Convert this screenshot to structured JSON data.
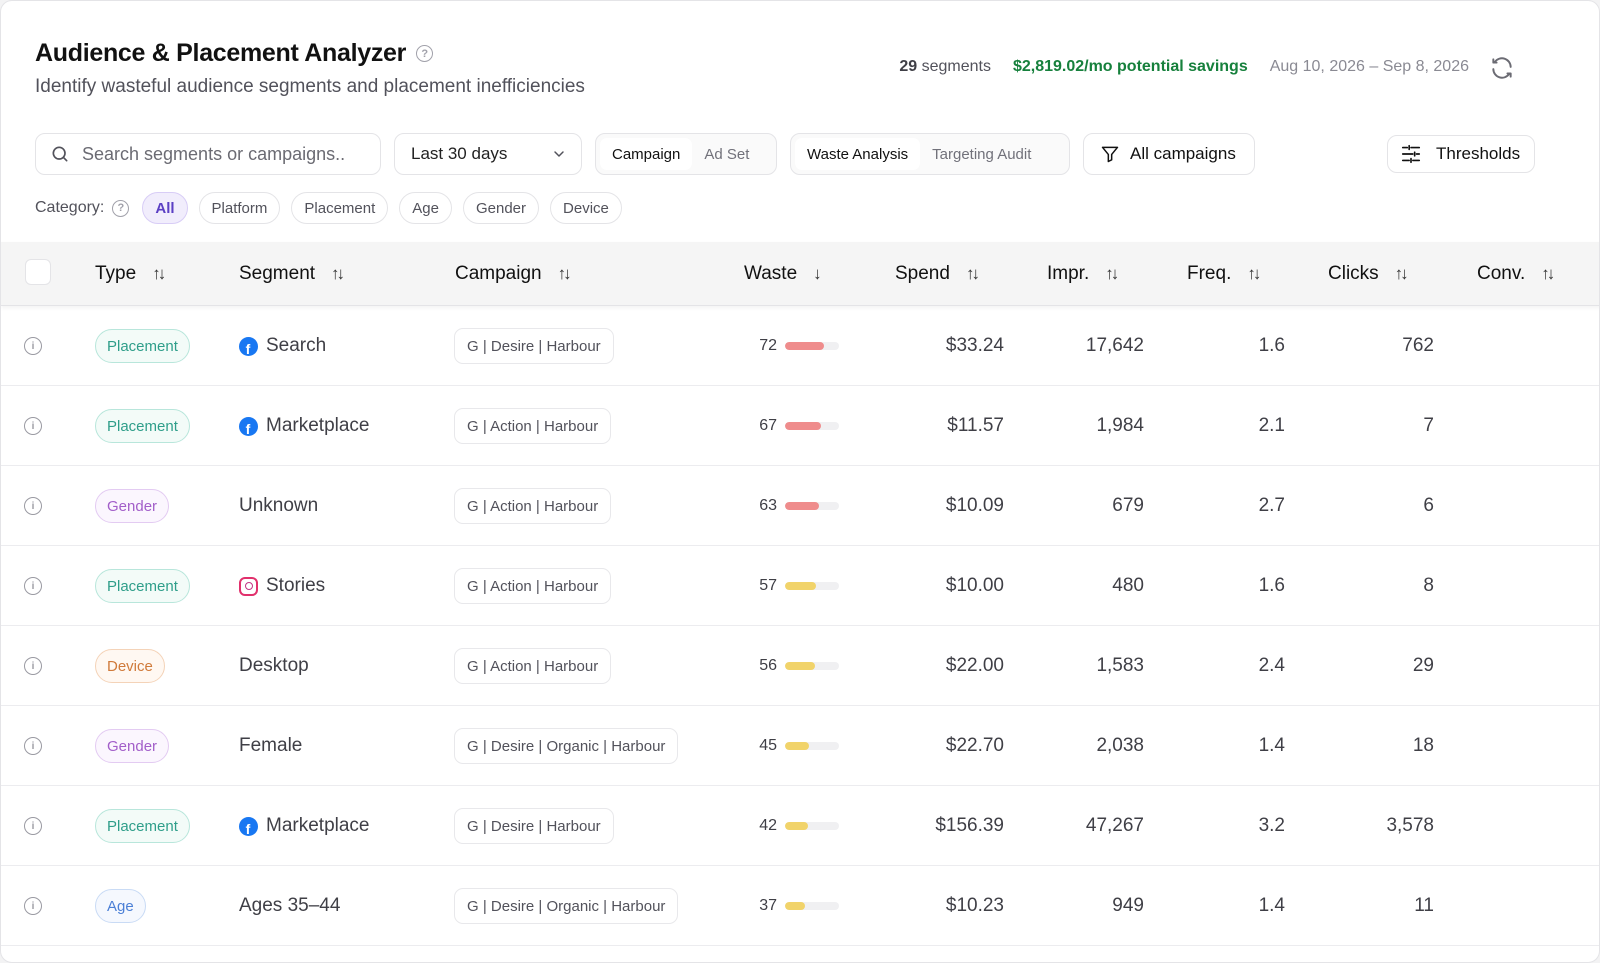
{
  "header": {
    "title": "Audience & Placement Analyzer",
    "help": "?",
    "subtitle": "Identify wasteful audience segments and placement inefficiencies",
    "segment_count": "29",
    "segment_suffix": "segments",
    "savings": "$2,819.02/mo potential savings",
    "date_range": "Aug 10, 2026 – Sep 8, 2026"
  },
  "toolbar": {
    "search_placeholder": "Search segments or campaigns..",
    "period": "Last 30 days",
    "level_options": [
      "Campaign",
      "Ad Set"
    ],
    "view_options": [
      "Waste Analysis",
      "Targeting Audit"
    ],
    "filter_label": "All campaigns",
    "thresholds_label": "Thresholds"
  },
  "categories": {
    "label": "Category:",
    "items": [
      "All",
      "Platform",
      "Placement",
      "Age",
      "Gender",
      "Device"
    ],
    "active": "All"
  },
  "table": {
    "columns": [
      "Type",
      "Segment",
      "Campaign",
      "Waste",
      "Spend",
      "Impr.",
      "Freq.",
      "Clicks",
      "Conv."
    ],
    "rows": [
      {
        "type": "Placement",
        "segment": "Search",
        "icon": "facebook-icon",
        "campaign": "G | Desire | Harbour",
        "waste": 72,
        "spend": "$33.24",
        "impr": "17,642",
        "freq": "1.6",
        "clicks": "762"
      },
      {
        "type": "Placement",
        "segment": "Marketplace",
        "icon": "facebook-icon",
        "campaign": "G | Action | Harbour",
        "waste": 67,
        "spend": "$11.57",
        "impr": "1,984",
        "freq": "2.1",
        "clicks": "7"
      },
      {
        "type": "Gender",
        "segment": "Unknown",
        "icon": "",
        "campaign": "G | Action | Harbour",
        "waste": 63,
        "spend": "$10.09",
        "impr": "679",
        "freq": "2.7",
        "clicks": "6"
      },
      {
        "type": "Placement",
        "segment": "Stories",
        "icon": "instagram-icon",
        "campaign": "G | Action | Harbour",
        "waste": 57,
        "spend": "$10.00",
        "impr": "480",
        "freq": "1.6",
        "clicks": "8"
      },
      {
        "type": "Device",
        "segment": "Desktop",
        "icon": "",
        "campaign": "G | Action | Harbour",
        "waste": 56,
        "spend": "$22.00",
        "impr": "1,583",
        "freq": "2.4",
        "clicks": "29"
      },
      {
        "type": "Gender",
        "segment": "Female",
        "icon": "",
        "campaign": "G | Desire | Organic | Harbour",
        "waste": 45,
        "spend": "$22.70",
        "impr": "2,038",
        "freq": "1.4",
        "clicks": "18"
      },
      {
        "type": "Placement",
        "segment": "Marketplace",
        "icon": "facebook-icon",
        "campaign": "G | Desire | Harbour",
        "waste": 42,
        "spend": "$156.39",
        "impr": "47,267",
        "freq": "3.2",
        "clicks": "3,578"
      },
      {
        "type": "Age",
        "segment": "Ages 35–44",
        "icon": "",
        "campaign": "G | Desire | Organic | Harbour",
        "waste": 37,
        "spend": "$10.23",
        "impr": "949",
        "freq": "1.4",
        "clicks": "11"
      }
    ]
  },
  "colors": {
    "savings": "#16803c",
    "waste_high": "#ef8c8c",
    "waste_medium": "#f1d36a",
    "accent": "#5b3fc4"
  }
}
